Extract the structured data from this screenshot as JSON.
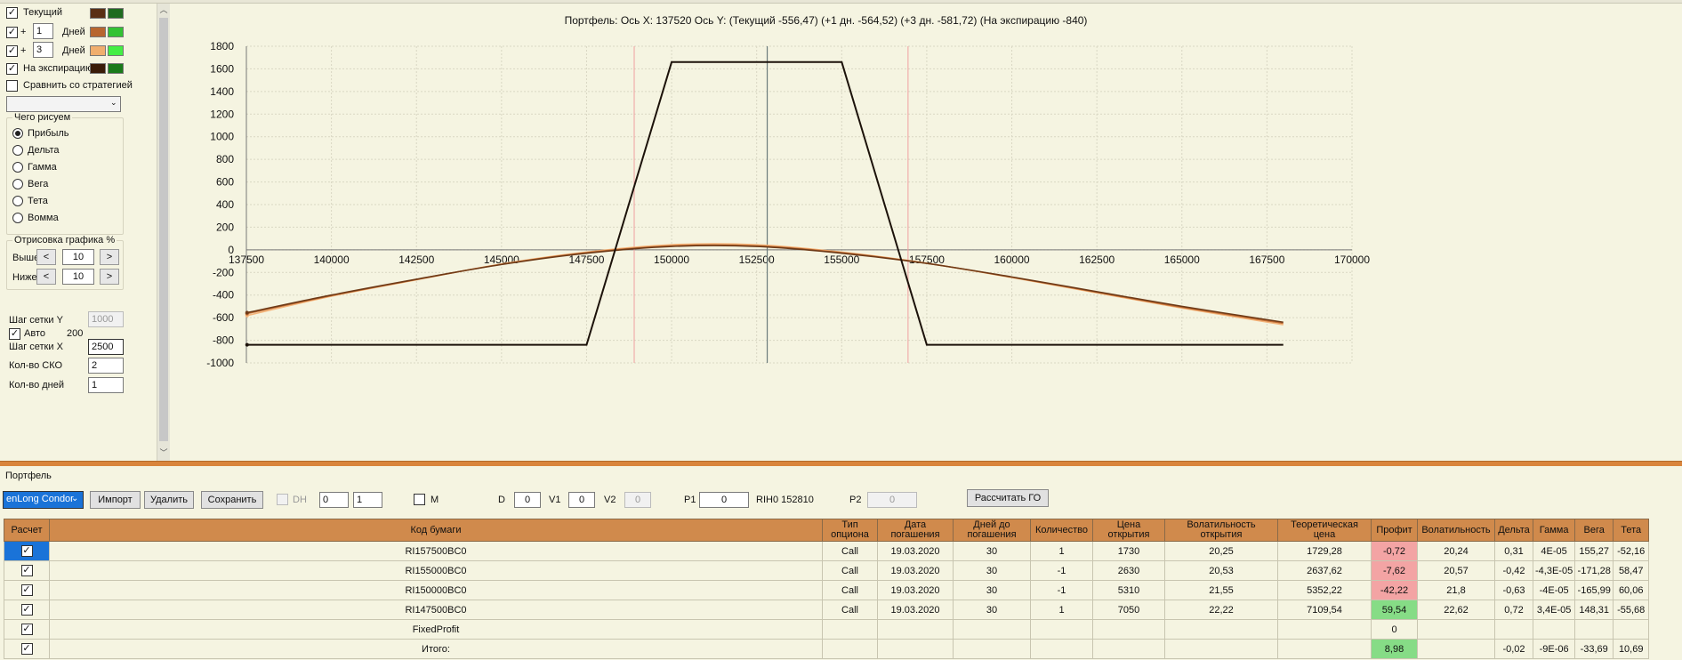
{
  "settings": {
    "current_label": "Текущий",
    "plus1_sign": "+",
    "plus1_days": "1",
    "plus1_unit": "Дней",
    "plus3_sign": "+",
    "plus3_days": "3",
    "plus3_unit": "Дней",
    "expiry_label": "На экспирацию",
    "compare_label": "Сравнить со стратегией",
    "what_group": "Чего рисуем",
    "radio": [
      "Прибыль",
      "Дельта",
      "Гамма",
      "Вега",
      "Тета",
      "Вомма"
    ],
    "range_group": "Отрисовка графика %",
    "above_label": "Выше",
    "above_val": "10",
    "below_label": "Ниже",
    "below_val": "10",
    "gridy_label": "Шаг сетки Y",
    "gridy_val": "1000",
    "auto_label": "Авто",
    "auto_val": "200",
    "gridx_label": "Шаг сетки X",
    "gridx_val": "2500",
    "sko_label": "Кол-во СКО",
    "sko_val": "2",
    "days_label": "Кол-во дней",
    "days_val": "1",
    "colors": {
      "cur1": "#5a2f14",
      "cur2": "#1f6b1f",
      "d1a": "#b7662f",
      "d1b": "#33c233",
      "d3a": "#f0ae6e",
      "d3b": "#44ee44",
      "exp1": "#3a1b08",
      "exp2": "#1a7a1a"
    }
  },
  "chart_data": {
    "type": "line",
    "title": "Портфель: Ось X:  137520 Ось Y:   (Текущий -556,47)  (+1 дн. -564,52)  (+3 дн. -581,72)  (На экспирацию -840)",
    "xlim": [
      137500,
      170000
    ],
    "ylim": [
      -1000,
      1800
    ],
    "xticks": [
      137500,
      140000,
      142500,
      145000,
      147500,
      150000,
      152500,
      155000,
      157500,
      160000,
      162500,
      165000,
      167500,
      170000
    ],
    "yticks": [
      1800,
      1600,
      1400,
      1200,
      1000,
      800,
      600,
      400,
      200,
      0,
      -200,
      -400,
      -600,
      -800,
      -1000
    ],
    "vlines_red": [
      148900,
      156950
    ],
    "vline_gray": 152810,
    "series": [
      {
        "name": "На экспирацию",
        "color": "#1c120a",
        "x": [
          137520,
          147500,
          150000,
          155000,
          157500,
          167980
        ],
        "y": [
          -840,
          -840,
          1660,
          1660,
          -840,
          -840
        ]
      },
      {
        "name": "Текущий",
        "color": "#6e3a17",
        "x": [
          137520,
          140000,
          142500,
          145000,
          147500,
          150000,
          152500,
          155000,
          157500,
          160000,
          162500,
          165000,
          167980
        ],
        "y": [
          -556,
          -400,
          -260,
          -130,
          -30,
          30,
          30,
          -30,
          -120,
          -240,
          -370,
          -500,
          -640
        ]
      },
      {
        "name": "+1 дн.",
        "color": "#c36d33",
        "x": [
          137520,
          140000,
          142500,
          145000,
          147500,
          150000,
          152500,
          155000,
          157500,
          160000,
          162500,
          165000,
          167980
        ],
        "y": [
          -564,
          -405,
          -262,
          -128,
          -25,
          35,
          35,
          -25,
          -120,
          -242,
          -375,
          -508,
          -650
        ]
      },
      {
        "name": "+3 дн.",
        "color": "#f4b47a",
        "x": [
          137520,
          140000,
          142500,
          145000,
          147500,
          150000,
          152500,
          155000,
          157500,
          160000,
          162500,
          165000,
          167980
        ],
        "y": [
          -581,
          -410,
          -265,
          -125,
          -20,
          45,
          45,
          -20,
          -118,
          -245,
          -380,
          -515,
          -662
        ]
      }
    ]
  },
  "portfolio": {
    "label": "Портфель",
    "strategy": "enLong Condor",
    "import": "Импорт",
    "delete": "Удалить",
    "save": "Сохранить",
    "dh": "DH",
    "dh1": "0",
    "dh2": "1",
    "m": "M",
    "d_label": "D",
    "d_val": "0",
    "v1_label": "V1",
    "v1_val": "0",
    "v2_label": "V2",
    "v2_val": "0",
    "p1_label": "P1",
    "p1_val": "0",
    "ticker": "RIH0 152810",
    "p2_label": "P2",
    "p2_val": "0",
    "calc_go": "Рассчитать ГО"
  },
  "table": {
    "headers": [
      "Расчет",
      "Код бумаги",
      "Тип опциона",
      "Дата погашения",
      "Дней до погашения",
      "Количество",
      "Цена открытия",
      "Волатильность открытия",
      "Теоретическая цена",
      "Профит",
      "Волатильность",
      "Дельта",
      "Гамма",
      "Вега",
      "Тета"
    ],
    "rows": [
      [
        "RI157500BC0",
        "Call",
        "19.03.2020",
        "30",
        "1",
        "1730",
        "20,25",
        "1729,28",
        "-0,72",
        "20,24",
        "0,31",
        "4E-05",
        "155,27",
        "-52,16"
      ],
      [
        "RI155000BC0",
        "Call",
        "19.03.2020",
        "30",
        "-1",
        "2630",
        "20,53",
        "2637,62",
        "-7,62",
        "20,57",
        "-0,42",
        "-4,3E-05",
        "-171,28",
        "58,47"
      ],
      [
        "RI150000BC0",
        "Call",
        "19.03.2020",
        "30",
        "-1",
        "5310",
        "21,55",
        "5352,22",
        "-42,22",
        "21,8",
        "-0,63",
        "-4E-05",
        "-165,99",
        "60,06"
      ],
      [
        "RI147500BC0",
        "Call",
        "19.03.2020",
        "30",
        "1",
        "7050",
        "22,22",
        "7109,54",
        "59,54",
        "22,62",
        "0,72",
        "3,4E-05",
        "148,31",
        "-55,68"
      ],
      [
        "FixedProfit",
        "",
        "",
        "",
        "",
        "",
        "",
        "",
        "0",
        "",
        "",
        "",
        "",
        ""
      ],
      [
        "Итого:",
        "",
        "",
        "",
        "",
        "",
        "",
        "",
        "8,98",
        "",
        "-0,02",
        "-9E-06",
        "-33,69",
        "10,69"
      ]
    ]
  }
}
